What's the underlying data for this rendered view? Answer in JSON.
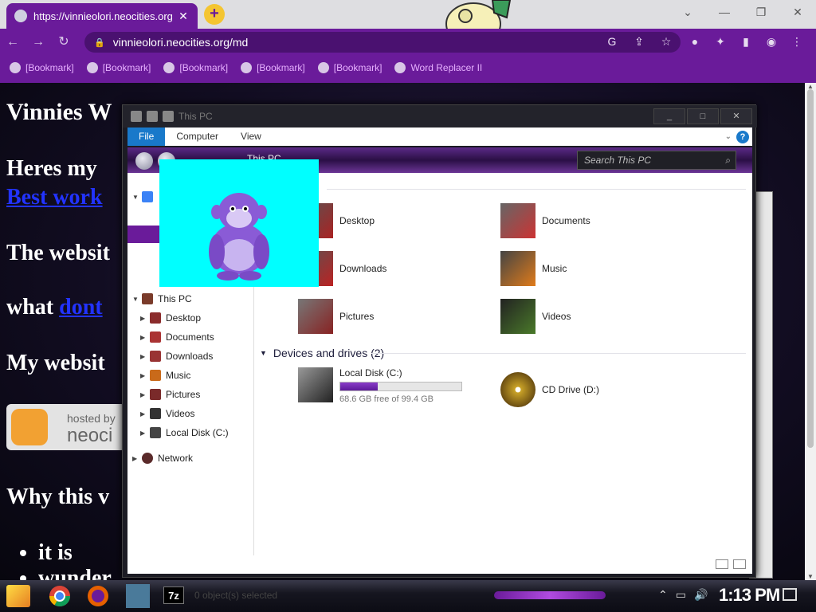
{
  "browser": {
    "tab_title": "https://vinnieolori.neocities.org",
    "tab_close": "✕",
    "new_tab": "+",
    "url": "vinnieolori.neocities.org/md",
    "window_controls": {
      "minimize": "—",
      "restore": "❐",
      "close": "✕"
    },
    "dropdown": "⌄"
  },
  "bookmarks": [
    {
      "label": "[Bookmark]"
    },
    {
      "label": "[Bookmark]"
    },
    {
      "label": "[Bookmark]"
    },
    {
      "label": "[Bookmark]"
    },
    {
      "label": "[Bookmark]"
    },
    {
      "label": "Word Replacer II"
    }
  ],
  "page": {
    "heading": "Vinnies W",
    "line1": "Heres my",
    "link1": "Best work",
    "line2": "The websit",
    "line3_prefix": "what ",
    "link2": "dont",
    "line4": "My websit",
    "badge_hosted": "hosted by",
    "badge_name": "neoci",
    "line5": "Why this v",
    "list_item1": "it is",
    "list_item2": "wunder"
  },
  "explorer": {
    "title": "This PC",
    "ribbon_tabs": [
      "File",
      "Computer",
      "View"
    ],
    "path": "This PC",
    "search_placeholder": "Search This PC",
    "nav": {
      "this_pc": "This PC",
      "desktop": "Desktop",
      "documents": "Documents",
      "downloads": "Downloads",
      "music": "Music",
      "pictures": "Pictures",
      "videos": "Videos",
      "local_disk": "Local Disk (C:)",
      "network": "Network"
    },
    "folders_group_suffix": ")",
    "folders": [
      "Desktop",
      "Documents",
      "Downloads",
      "Music",
      "Pictures",
      "Videos"
    ],
    "devices_group": "Devices and drives (2)",
    "drive_c": {
      "name": "Local Disk (C:)",
      "free": "68.6 GB free of 99.4 GB",
      "used_fraction": 0.31
    },
    "drive_d": {
      "name": "CD Drive (D:)"
    },
    "status": "0 object(s) selected"
  },
  "taskbar": {
    "app_7z": "7z",
    "clock": "1:13 PM"
  },
  "colors": {
    "accent": "#6a1b9a",
    "bookmark_text": "#e7b0ff",
    "popup_bg": "#00ffff",
    "link": "#2233ff"
  }
}
